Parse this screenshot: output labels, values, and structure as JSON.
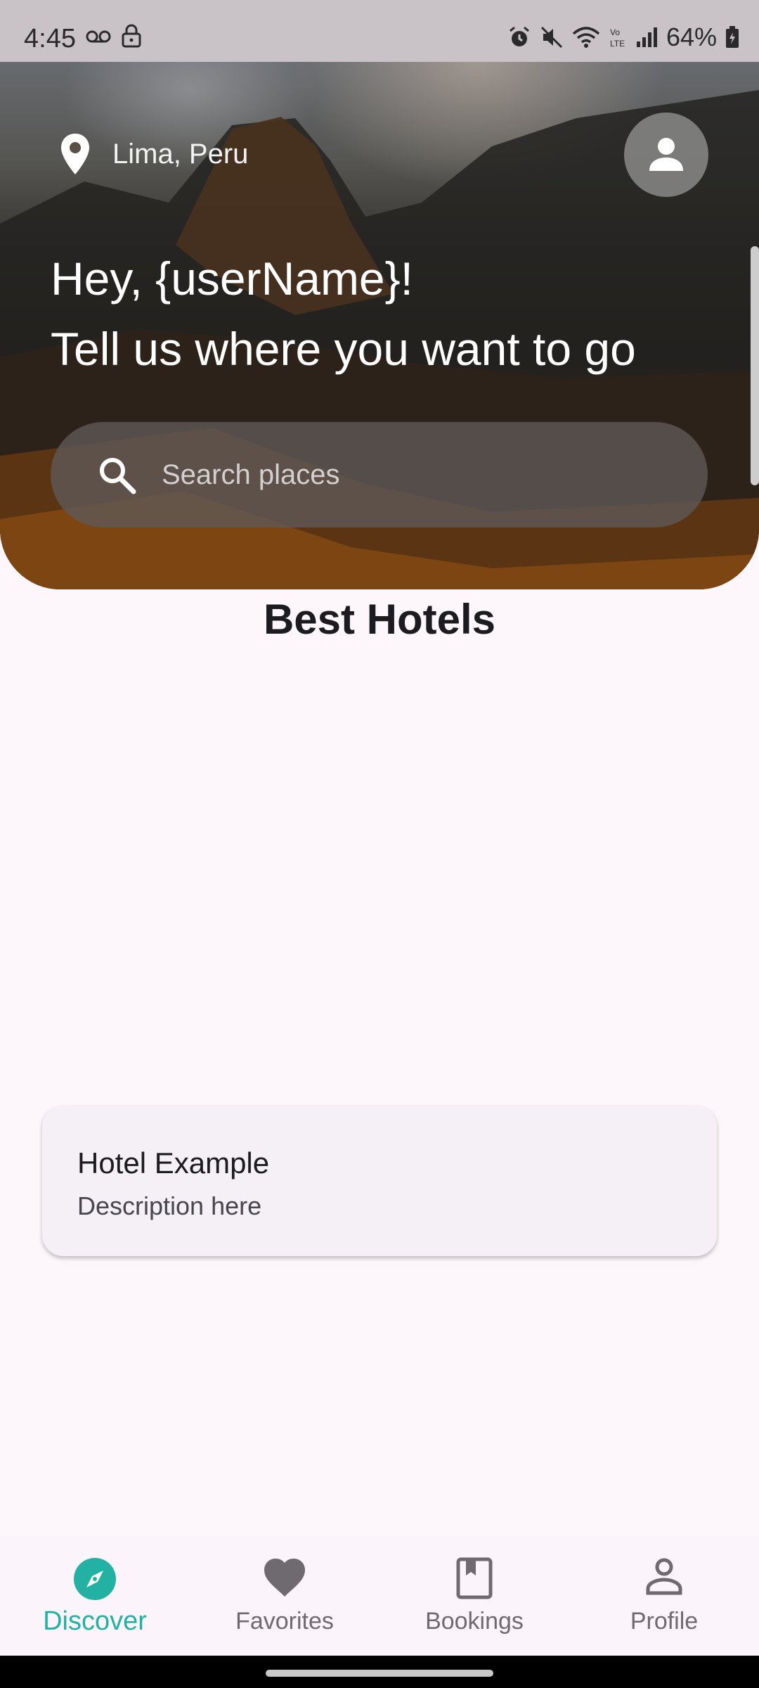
{
  "status_bar": {
    "time": "4:45",
    "battery": "64%",
    "icons": [
      "voicemail-icon",
      "lock-icon",
      "alarm-icon",
      "mute-icon",
      "wifi-icon",
      "volte-icon",
      "signal-icon",
      "battery-icon"
    ]
  },
  "header": {
    "location": "Lima, Peru",
    "greeting_line1": "Hey, {userName}!",
    "greeting_line2": "Tell us where you want to go",
    "search_placeholder": "Search places"
  },
  "main": {
    "section_title": "Best Hotels",
    "hotels": [
      {
        "name": "Hotel Example",
        "description": "Description here"
      }
    ]
  },
  "bottom_nav": {
    "items": [
      {
        "label": "Discover",
        "icon": "compass-icon",
        "active": true
      },
      {
        "label": "Favorites",
        "icon": "heart-icon",
        "active": false
      },
      {
        "label": "Bookings",
        "icon": "book-icon",
        "active": false
      },
      {
        "label": "Profile",
        "icon": "person-icon",
        "active": false
      }
    ]
  },
  "colors": {
    "accent": "#23b1a4",
    "background": "#fdf7fc",
    "status_bar": "#c9c3c8",
    "card": "#f4f0f6"
  }
}
